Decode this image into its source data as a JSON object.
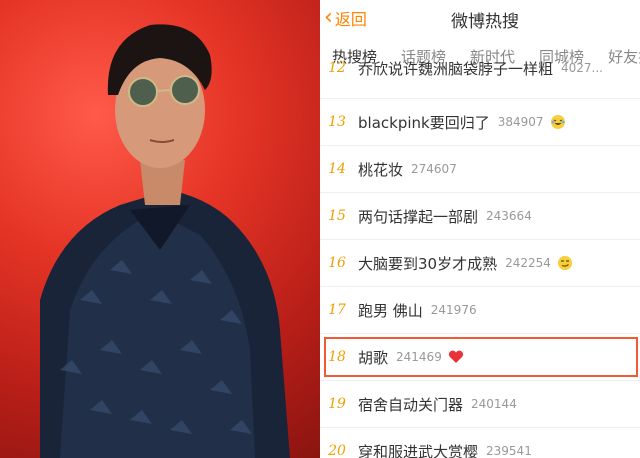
{
  "header": {
    "back_label": "返回",
    "title": "微博热搜"
  },
  "tabs": [
    {
      "label": "热搜榜",
      "active": true
    },
    {
      "label": "话题榜"
    },
    {
      "label": "新时代"
    },
    {
      "label": "同城榜"
    },
    {
      "label": "好友搜"
    }
  ],
  "rows": [
    {
      "rank": "12",
      "name": "乔欣说许魏洲脑袋脖子一样粗",
      "count": "4027..."
    },
    {
      "rank": "13",
      "name": "blackpink要回归了",
      "count": "384907",
      "emoji": "laugh-cry-emoji"
    },
    {
      "rank": "14",
      "name": "桃花妆",
      "count": "274607"
    },
    {
      "rank": "15",
      "name": "两句话撑起一部剧",
      "count": "243664"
    },
    {
      "rank": "16",
      "name": "大脑要到30岁才成熟",
      "count": "242254",
      "emoji": "smirk-emoji"
    },
    {
      "rank": "17",
      "name": "跑男 佛山",
      "count": "241976"
    },
    {
      "rank": "18",
      "name": "胡歌",
      "count": "241469",
      "emoji": "heart-emoji"
    },
    {
      "rank": "19",
      "name": "宿舍自动关门器",
      "count": "240144"
    },
    {
      "rank": "20",
      "name": "穿和服进武大赏樱",
      "count": "239541"
    }
  ],
  "colors": {
    "accent": "#ff8200",
    "highlight": "#f25a35",
    "background_red": "#e53426"
  }
}
